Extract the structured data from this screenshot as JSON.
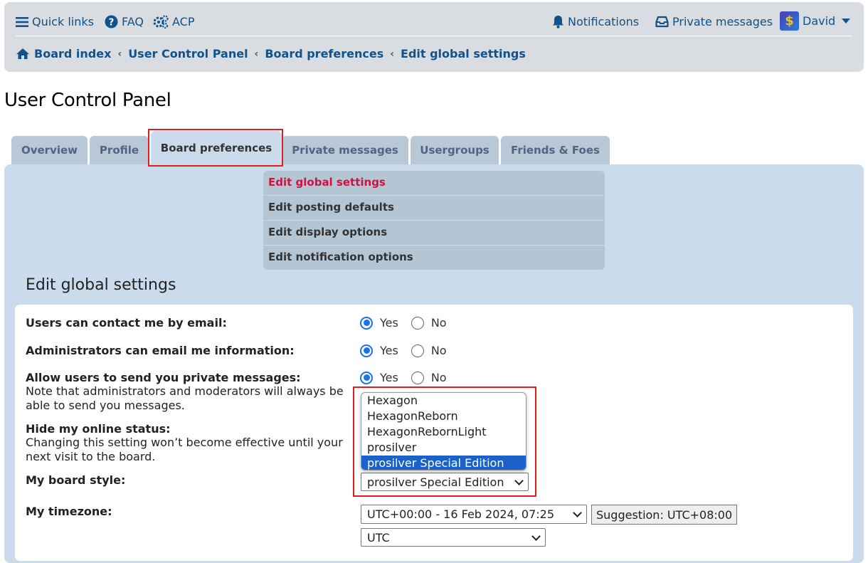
{
  "nav": {
    "quick_links": "Quick links",
    "faq": "FAQ",
    "acp": "ACP",
    "notifications": "Notifications",
    "private_messages": "Private messages",
    "user": "David"
  },
  "breadcrumb": [
    "Board index",
    "User Control Panel",
    "Board preferences",
    "Edit global settings"
  ],
  "page_title": "User Control Panel",
  "tabs": [
    "Overview",
    "Profile",
    "Board preferences",
    "Private messages",
    "Usergroups",
    "Friends & Foes"
  ],
  "active_tab": "Board preferences",
  "submenu": [
    "Edit global settings",
    "Edit posting defaults",
    "Edit display options",
    "Edit notification options"
  ],
  "active_submenu": "Edit global settings",
  "section_title": "Edit global settings",
  "form": {
    "contact_email_label": "Users can contact me by email:",
    "admin_email_label": "Administrators can email me information:",
    "allow_pm_label": "Allow users to send you private messages:",
    "allow_pm_explain": "Note that administrators and moderators will always be able to send you messages.",
    "hide_online_label": "Hide my online status:",
    "hide_online_explain": "Changing this setting won’t become effective until your next visit to the board.",
    "board_style_label": "My board style:",
    "timezone_label": "My timezone:",
    "yes": "Yes",
    "no": "No",
    "style_options": [
      "Hexagon",
      "HexagonReborn",
      "HexagonRebornLight",
      "prosilver",
      "prosilver Special Edition"
    ],
    "style_selected": "prosilver Special Edition",
    "timezone_date_value": "UTC+00:00 - 16 Feb 2024, 07:25",
    "timezone_suggestion": "Suggestion: UTC+08:00",
    "timezone_value": "UTC"
  },
  "colors": {
    "link": "#105289",
    "active_submenu": "#d31141",
    "highlight_outline": "#e01e1e",
    "selected_option": "#1a62c9"
  }
}
